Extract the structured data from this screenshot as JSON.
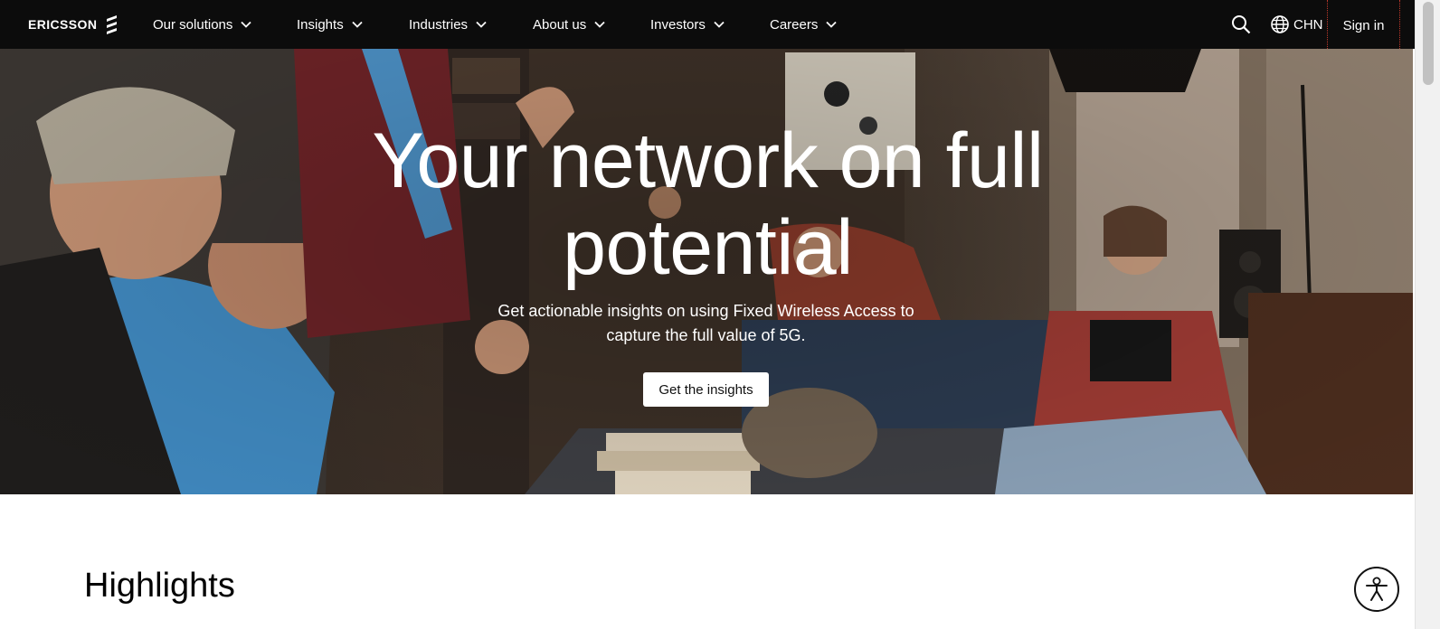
{
  "brand": {
    "logo_text": "ERICSSON"
  },
  "nav": {
    "items": [
      {
        "label": "Our solutions"
      },
      {
        "label": "Insights"
      },
      {
        "label": "Industries"
      },
      {
        "label": "About us"
      },
      {
        "label": "Investors"
      },
      {
        "label": "Careers"
      }
    ],
    "language": "CHN",
    "signin": "Sign in"
  },
  "hero": {
    "title": "Your network on full potential",
    "subtitle": "Get actionable insights on using Fixed Wireless Access to capture the full value of 5G.",
    "cta": "Get the insights"
  },
  "highlights": {
    "heading": "Highlights"
  },
  "icons": {
    "logo": "ericsson-logo-icon",
    "search": "search-icon",
    "language": "globe-icon",
    "chevron": "chevron-down-icon",
    "accessibility": "accessibility-icon"
  },
  "colors": {
    "nav_bg": "#0c0c0c",
    "text_light": "#ffffff",
    "cta_bg": "#ffffff",
    "page_bg": "#ffffff"
  }
}
